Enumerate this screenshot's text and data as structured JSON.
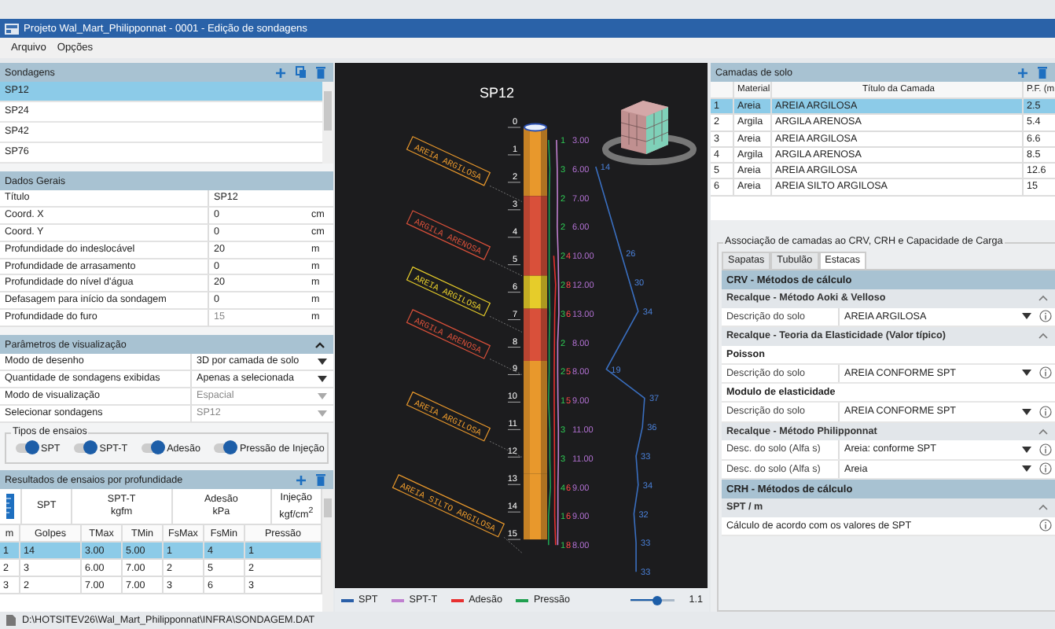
{
  "window": {
    "title": "Projeto Wal_Mart_Philipponnat - 0001 - Edição de sondagens"
  },
  "menu": [
    "Arquivo",
    "Opções"
  ],
  "sondagens": {
    "title": "Sondagens",
    "items": [
      {
        "label": "SP12",
        "selected": true
      },
      {
        "label": "SP24",
        "selected": false
      },
      {
        "label": "SP42",
        "selected": false
      },
      {
        "label": "SP76",
        "selected": false
      }
    ]
  },
  "dados_gerais": {
    "title": "Dados Gerais",
    "rows": [
      {
        "label": "Título",
        "value": "SP12",
        "disabled": false
      },
      {
        "label": "Coord. X",
        "value": "0",
        "unit": "cm",
        "disabled": false
      },
      {
        "label": "Coord. Y",
        "value": "0",
        "unit": "cm",
        "disabled": false
      },
      {
        "label": "Profundidade do indeslocável",
        "value": "20",
        "unit": "m",
        "disabled": false
      },
      {
        "label": "Profundidade de arrasamento",
        "value": "0",
        "unit": "m",
        "disabled": false
      },
      {
        "label": "Profundidade do nível d'água",
        "value": "20",
        "unit": "m",
        "disabled": false
      },
      {
        "label": "Defasagem para início da sondagem",
        "value": "0",
        "unit": "m",
        "disabled": false
      },
      {
        "label": "Profundidade do furo",
        "value": "15",
        "unit": "m",
        "disabled": true
      }
    ]
  },
  "visualizacao": {
    "title": "Parâmetros de visualização",
    "expanded": true,
    "rows": [
      {
        "label": "Modo de desenho",
        "value": "3D por camada de solo",
        "disabled": false
      },
      {
        "label": "Quantidade de sondagens exibidas",
        "value": "Apenas a selecionada",
        "disabled": false
      },
      {
        "label": "Modo de visualização",
        "value": "Espacial",
        "disabled": true
      },
      {
        "label": "Selecionar sondagens",
        "value": "SP12",
        "disabled": true
      }
    ]
  },
  "tipos_de_ensaios": {
    "title": "Tipos de ensaios",
    "toggles": [
      {
        "label": "SPT",
        "on": true
      },
      {
        "label": "SPT-T",
        "on": true
      },
      {
        "label": "Adesão",
        "on": true
      },
      {
        "label": "Pressão de Injeção",
        "on": true
      }
    ]
  },
  "resultados": {
    "title": "Resultados de ensaios por profundidade",
    "groups": [
      {
        "label": "SPT"
      },
      {
        "label": "SPT-T",
        "unit": "kgfm"
      },
      {
        "label": "Adesão",
        "unit": "kPa"
      },
      {
        "label": "Injeção",
        "unit": "kgf/cm$^{2}$"
      }
    ],
    "columns": [
      "m",
      "Golpes",
      "TMax",
      "TMin",
      "FsMax",
      "FsMin",
      "Pressão"
    ],
    "rows": [
      {
        "cells": [
          "1",
          "14",
          "3.00",
          "5.00",
          "1",
          "4",
          "1"
        ],
        "selected": true
      },
      {
        "cells": [
          "2",
          "3",
          "6.00",
          "7.00",
          "2",
          "5",
          "2"
        ],
        "selected": false
      },
      {
        "cells": [
          "3",
          "2",
          "7.00",
          "7.00",
          "3",
          "6",
          "3"
        ],
        "selected": false
      }
    ]
  },
  "viewer": {
    "title": "SP12",
    "depths": [
      "0",
      "1",
      "2",
      "3",
      "4",
      "5",
      "6",
      "7",
      "8",
      "9",
      "10",
      "11",
      "12",
      "13",
      "14",
      "15"
    ],
    "layers": [
      {
        "label": "AREIA ARGILOSA",
        "color": "#e8982c"
      },
      {
        "label": "ARGILA ARENOSA",
        "color": "#d9503a"
      },
      {
        "label": "AREIA ARGILOSA",
        "color": "#e6cc2a"
      },
      {
        "label": "ARGILA ARENOSA",
        "color": "#d9503a"
      },
      {
        "label": "AREIA ARGILOSA",
        "color": "#e8982c"
      },
      {
        "label": "AREIA SILTO ARGILOSA",
        "color": "#e8982c"
      }
    ],
    "readings": [
      {
        "pressao": "1",
        "sptt": "3.00",
        "spt": "14"
      },
      {
        "pressao": "3",
        "sptt": "6.00"
      },
      {
        "pressao": "2",
        "sptt": "7.00"
      },
      {
        "pressao": "2",
        "sptt": "6.00",
        "spt": "26"
      },
      {
        "pressao": "2",
        "adesao": "4",
        "sptt": "10.00",
        "spt": "30"
      },
      {
        "pressao": "2",
        "adesao": "8",
        "sptt": "12.00",
        "spt": "34"
      },
      {
        "pressao": "3",
        "adesao": "6",
        "sptt": "13.00"
      },
      {
        "pressao": "2",
        "sptt": "8.00",
        "spt": "19"
      },
      {
        "pressao": "2",
        "adesao": "5",
        "sptt": "8.00",
        "spt": "37"
      },
      {
        "pressao": "1",
        "adesao": "5",
        "sptt": "9.00",
        "spt": "36"
      },
      {
        "pressao": "3",
        "sptt": "11.00",
        "spt": "33"
      },
      {
        "pressao": "3",
        "sptt": "11.00",
        "spt": "34"
      },
      {
        "pressao": "4",
        "adesao": "6",
        "sptt": "9.00",
        "spt": "32"
      },
      {
        "pressao": "1",
        "adesao": "6",
        "sptt": "9.00",
        "spt": "33"
      },
      {
        "pressao": "1",
        "adesao": "8",
        "sptt": "8.00",
        "spt": "33"
      }
    ],
    "legend": [
      {
        "label": "SPT",
        "color": "#2a5fa8"
      },
      {
        "label": "SPT-T",
        "color": "#c080d0"
      },
      {
        "label": "Adesão",
        "color": "#e83030"
      },
      {
        "label": "Pressão",
        "color": "#20a050"
      }
    ],
    "scale": {
      "level": 0.6,
      "reading": "1.1"
    }
  },
  "soil_layers": {
    "title": "Camadas de solo",
    "columns": [
      "Material",
      "Título da Camada",
      "P.F. (m"
    ],
    "rows": [
      {
        "index": "1",
        "material": "Areia",
        "title": "AREIA ARGILOSA",
        "pf": "2.5",
        "selected": true
      },
      {
        "index": "2",
        "material": "Argila",
        "title": "ARGILA ARENOSA",
        "pf": "5.4",
        "selected": false
      },
      {
        "index": "3",
        "material": "Areia",
        "title": "AREIA ARGILOSA",
        "pf": "6.6",
        "selected": false
      },
      {
        "index": "4",
        "material": "Argila",
        "title": "ARGILA ARENOSA",
        "pf": "8.5",
        "selected": false
      },
      {
        "index": "5",
        "material": "Areia",
        "title": "AREIA ARGILOSA",
        "pf": "12.6",
        "selected": false
      },
      {
        "index": "6",
        "material": "Areia",
        "title": "AREIA SILTO ARGILOSA",
        "pf": "15",
        "selected": false
      }
    ]
  },
  "association": {
    "title": "Associação de camadas ao CRV, CRH e Capacidade de Carga",
    "tabs": [
      {
        "label": "Sapatas",
        "selected": false
      },
      {
        "label": "Tubulão",
        "selected": false
      },
      {
        "label": "Estacas",
        "selected": true
      }
    ],
    "sections": [
      {
        "title": "CRV - Métodos de cálculo",
        "groups": [
          {
            "title": "Recalque - Método Aoki & Velloso",
            "expanded": true,
            "items": [
              {
                "kind": "field",
                "label": "Descrição do solo",
                "value": "AREIA ARGILOSA"
              }
            ]
          },
          {
            "title": "Recalque - Teoria da Elasticidade (Valor típico)",
            "expanded": true,
            "items": [
              {
                "kind": "subheading",
                "label": "Poisson"
              },
              {
                "kind": "field",
                "label": "Descrição do solo",
                "value": "AREIA CONFORME SPT"
              },
              {
                "kind": "subheading",
                "label": "Modulo de elasticidade"
              },
              {
                "kind": "field",
                "label": "Descrição do solo",
                "value": "AREIA CONFORME SPT"
              }
            ]
          },
          {
            "title": "Recalque - Método Philipponnat",
            "expanded": true,
            "items": [
              {
                "kind": "field",
                "label": "Desc. do solo (Alfa s)",
                "value": "Areia: conforme SPT"
              },
              {
                "kind": "field",
                "label": "Desc. do solo (Alfa s)",
                "value": "Areia"
              }
            ]
          }
        ]
      },
      {
        "title": "CRH - Métodos de cálculo",
        "groups": [
          {
            "title": "SPT / m",
            "expanded": true,
            "items": [
              {
                "kind": "note",
                "label": "Cálculo de acordo com os valores de SPT"
              }
            ]
          }
        ]
      }
    ]
  },
  "status_bar": {
    "path": "D:\\HOTSITEV26\\Wal_Mart_Philipponnat\\INFRA\\SONDAGEM.DAT"
  }
}
